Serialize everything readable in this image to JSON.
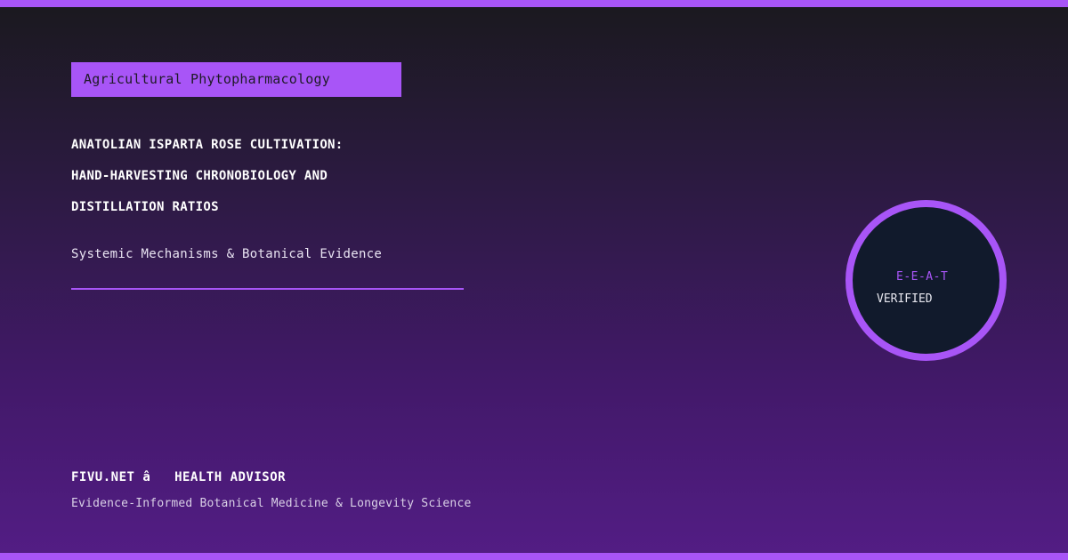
{
  "category": "Agricultural Phytopharmacology",
  "title_lines": [
    "ANATOLIAN ISPARTA ROSE CULTIVATION:",
    "HAND-HARVESTING CHRONOBIOLOGY AND",
    "DISTILLATION RATIOS"
  ],
  "subtitle": "Systemic Mechanisms & Botanical Evidence",
  "seal": {
    "top_text": "E-E-A-T",
    "bottom_text": "VERIFIED"
  },
  "footer": {
    "brand": "FIVU.NET â   HEALTH ADVISOR",
    "tagline": "Evidence-Informed Botanical Medicine & Longevity Science"
  },
  "colors": {
    "accent": "#a855f7",
    "seal_background": "#111a2c",
    "background_top": "#1a191e",
    "background_bottom": "#531d85"
  }
}
